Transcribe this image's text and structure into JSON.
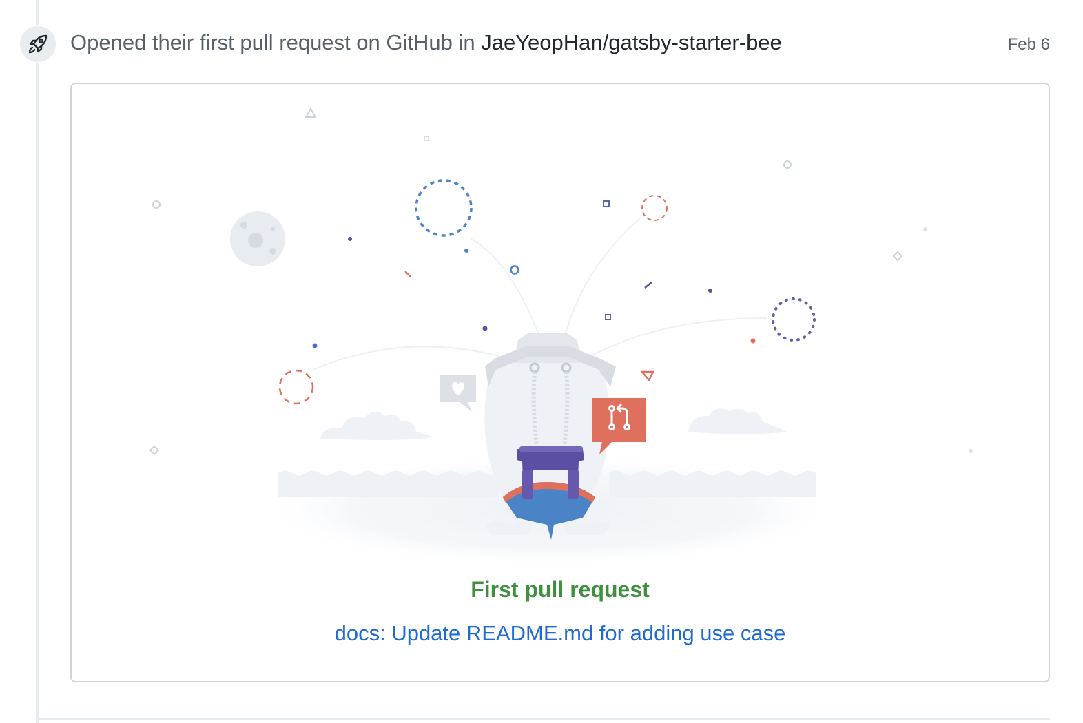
{
  "event": {
    "icon": "rocket-icon",
    "text_prefix": "Opened their first pull request on GitHub in ",
    "repo": "JaeYeopHan/gatsby-starter-bee",
    "date": "Feb 6"
  },
  "card": {
    "title": "First pull request",
    "pr_title": "docs: Update README.md for adding use case",
    "illustration": "first-pull-request-illustration"
  },
  "colors": {
    "title_green": "#3e8f3e",
    "link_blue": "#1f6bd3",
    "accent_red": "#e0705e",
    "accent_purple": "#5b4fa3",
    "accent_blue": "#4a83c6"
  }
}
